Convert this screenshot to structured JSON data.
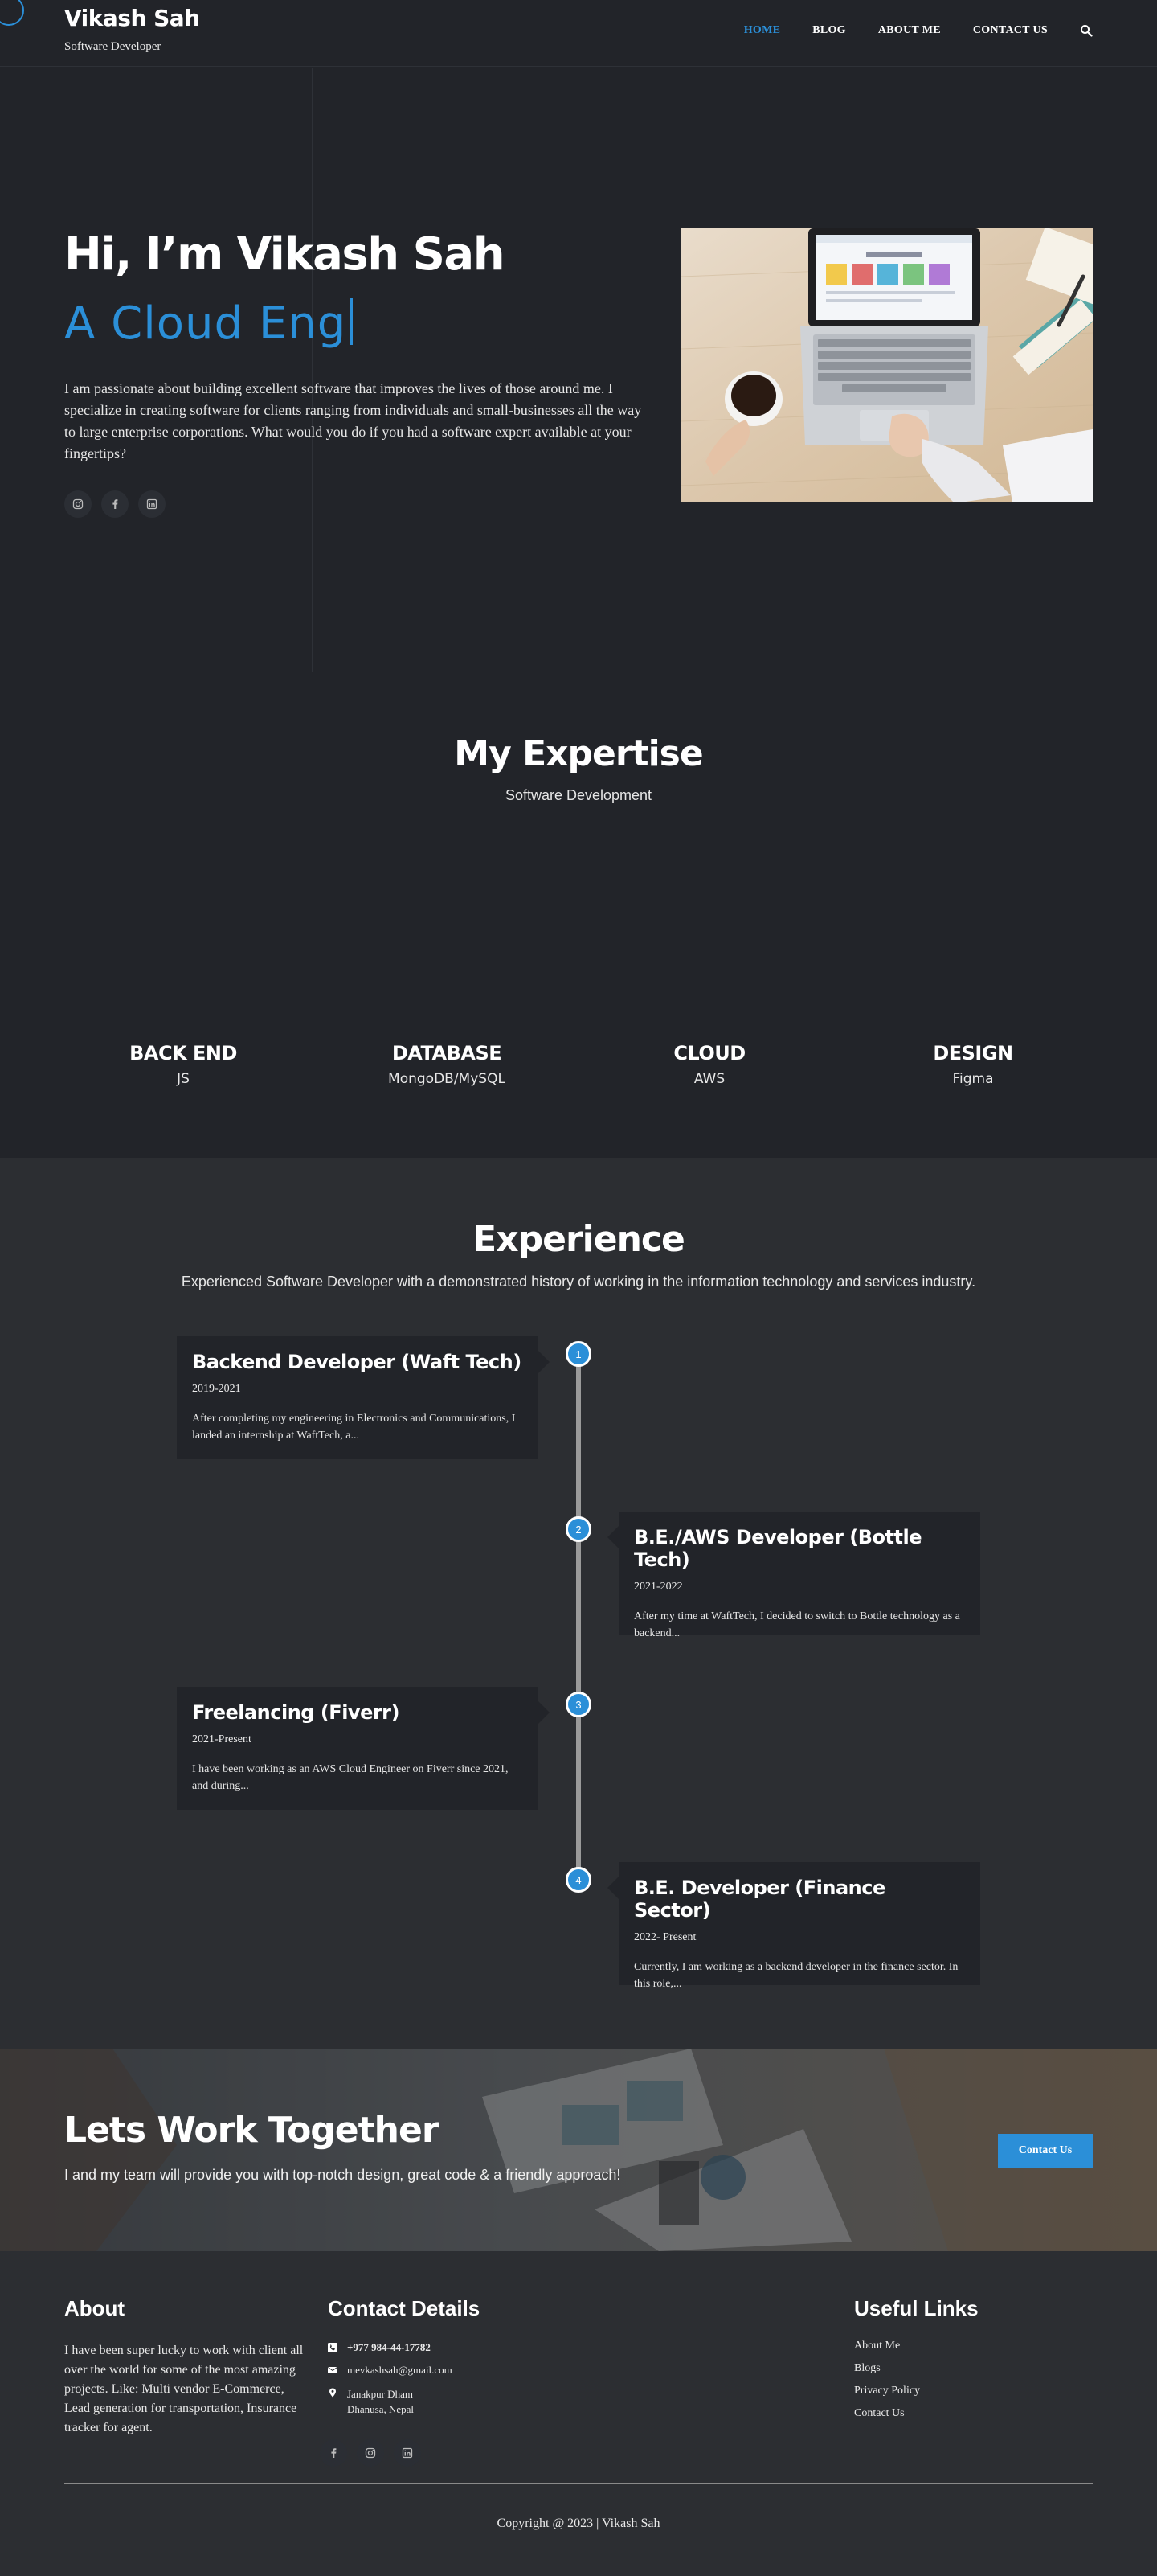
{
  "header": {
    "brand_name": "Vikash Sah",
    "brand_tagline": "Software Developer",
    "nav": [
      {
        "label": "HOME",
        "active": true
      },
      {
        "label": "BLOG"
      },
      {
        "label": "ABOUT ME"
      },
      {
        "label": "CONTACT US"
      }
    ],
    "search_icon": "search-icon"
  },
  "hero": {
    "title": "Hi, I’m Vikash Sah",
    "typed_text": "A Cloud Eng",
    "description": "I am passionate about building excellent software that improves the lives of those around me. I specialize in creating software for clients ranging from individuals and small-businesses all the way to large enterprise corporations. What would you do if you had a software expert available at your fingertips?",
    "socials": [
      "instagram-icon",
      "facebook-icon",
      "linkedin-icon"
    ]
  },
  "expertise": {
    "title": "My Expertise",
    "subtitle": "Software Development",
    "items": [
      {
        "title": "BACK END",
        "value": "JS"
      },
      {
        "title": "DATABASE",
        "value": "MongoDB/MySQL"
      },
      {
        "title": "CLOUD",
        "value": "AWS"
      },
      {
        "title": "DESIGN",
        "value": "Figma"
      }
    ]
  },
  "experience": {
    "title": "Experience",
    "subtitle": "Experienced Software Developer with a demonstrated history of working in the information technology and services industry.",
    "items": [
      {
        "num": "1",
        "role": "Backend Developer (Waft Tech)",
        "years": "2019-2021",
        "desc": "After completing my engineering in Electronics and Communications, I landed an internship at WaftTech, a..."
      },
      {
        "num": "2",
        "role": "B.E./AWS Developer (Bottle Tech)",
        "years": "2021-2022",
        "desc": "After my time at WaftTech, I decided to switch to Bottle technology as a backend..."
      },
      {
        "num": "3",
        "role": "Freelancing (Fiverr)",
        "years": "2021-Present",
        "desc": "I have been working as an AWS Cloud Engineer on Fiverr since 2021, and during..."
      },
      {
        "num": "4",
        "role": "B.E. Developer (Finance Sector)",
        "years": "2022- Present",
        "desc": "Currently, I am working as a backend developer in the finance sector. In this role,..."
      }
    ]
  },
  "cta": {
    "title": "Lets Work Together",
    "subtitle": "I and my team will provide you with top-notch design, great code & a friendly approach!",
    "button": "Contact Us"
  },
  "footer": {
    "about_title": "About",
    "about_text": "I have been super lucky to work with client all over the world for some of the most amazing projects. Like: Multi vendor E-Commerce, Lead generation for transportation, Insurance tracker for agent.",
    "contact_title": "Contact Details",
    "phone": "+977 984-44-17782",
    "email": "mevkashsah@gmail.com",
    "address_line1": "Janakpur Dham",
    "address_line2": "Dhanusa, Nepal",
    "socials": [
      "facebook-icon",
      "instagram-icon",
      "linkedin-icon"
    ],
    "links_title": "Useful Links",
    "links": [
      "About Me",
      "Blogs",
      "Privacy Policy",
      "Contact Us"
    ],
    "copyright": "Copyright @ 2023 | Vikash Sah"
  },
  "colors": {
    "accent": "#2b8fd8",
    "background": "#222429",
    "section_alt": "#2c2e32"
  }
}
